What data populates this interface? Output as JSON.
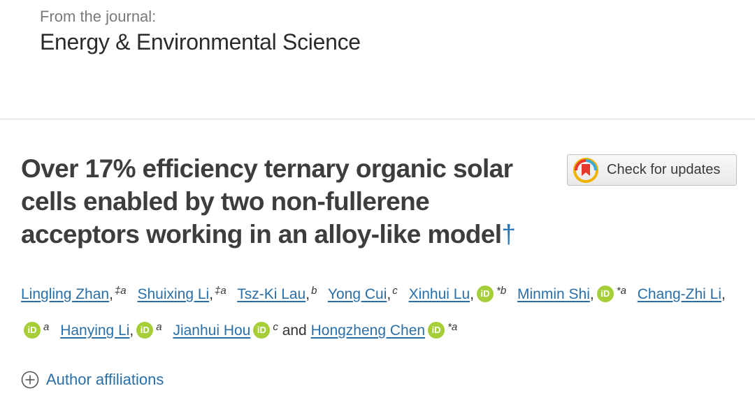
{
  "journal": {
    "from_label": "From the journal:",
    "name": "Energy & Environmental Science"
  },
  "article": {
    "title": "Over 17% efficiency ternary organic solar cells enabled by two non-fullerene acceptors working in an alloy-like model",
    "title_footnote": "†"
  },
  "updates_button": {
    "label": "Check for updates",
    "icon": "crossmark-icon"
  },
  "authors": [
    {
      "name": "Lingling Zhan",
      "punct": ",",
      "sup": "‡a",
      "orcid": false,
      "orcid_suffix": ""
    },
    {
      "name": "Shuixing Li",
      "punct": ",",
      "sup": "‡a",
      "orcid": false,
      "orcid_suffix": ""
    },
    {
      "name": "Tsz-Ki Lau",
      "punct": ",",
      "sup": "b",
      "orcid": false,
      "orcid_suffix": ""
    },
    {
      "name": "Yong Cui",
      "punct": ",",
      "sup": "c",
      "orcid": false,
      "orcid_suffix": ""
    },
    {
      "name": "Xinhui Lu",
      "punct": ",",
      "sup": "",
      "orcid": true,
      "orcid_suffix": "*b"
    },
    {
      "name": "Minmin Shi",
      "punct": ",",
      "sup": "",
      "orcid": true,
      "orcid_suffix": "*a"
    },
    {
      "name": "Chang-Zhi Li",
      "punct": ",",
      "sup": "",
      "orcid": true,
      "orcid_suffix": "a"
    },
    {
      "name": "Hanying Li",
      "punct": ",",
      "sup": "",
      "orcid": true,
      "orcid_suffix": "a"
    },
    {
      "name": "Jianhui Hou",
      "punct": "",
      "sup": "",
      "orcid": true,
      "orcid_suffix": "c"
    },
    {
      "name": "Hongzheng Chen",
      "punct": "",
      "sup": "",
      "orcid": true,
      "orcid_suffix": "*a"
    }
  ],
  "authors_conjunction": "and",
  "orcid_label": "iD",
  "affiliations": {
    "label": "Author affiliations",
    "icon": "plus-circle-icon"
  },
  "colors": {
    "link": "#2a6fa8",
    "orcid_green": "#a6ce39",
    "title": "#3d3d3d"
  }
}
